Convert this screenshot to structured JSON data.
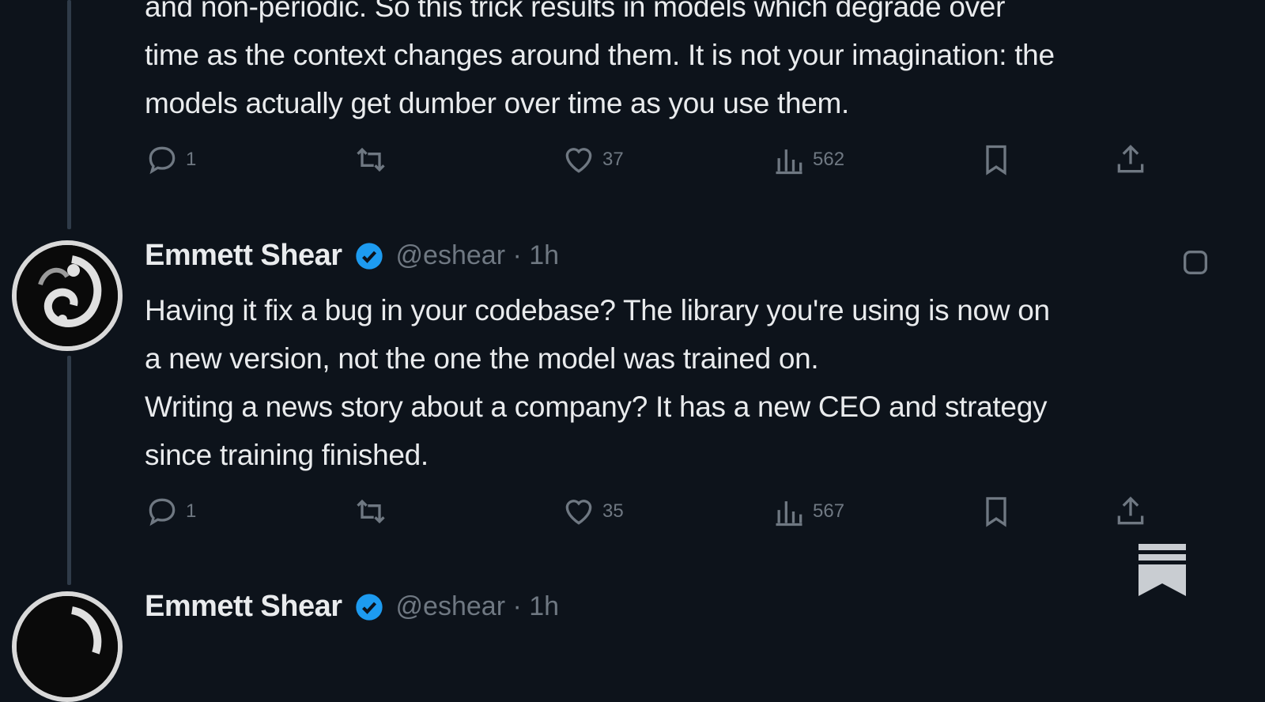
{
  "tweets": [
    {
      "text_lines": [
        "and non-periodic. So this trick results in models which degrade over",
        "time as the context changes around them. It is not your imagination: the",
        "models actually get dumber over time as you use them."
      ],
      "actions": {
        "reply": "1",
        "retweet": "",
        "like": "37",
        "views": "562"
      }
    },
    {
      "author": "Emmett Shear",
      "handle": "@eshear · 1h",
      "text_lines": [
        "Having it fix a bug in your codebase? The library you're using is now on",
        "a new version, not the one the model was trained on.",
        "Writing a news story about a company? It has a new CEO and strategy",
        "since training finished."
      ],
      "actions": {
        "reply": "1",
        "retweet": "",
        "like": "35",
        "views": "567"
      }
    },
    {
      "author": "Emmett Shear",
      "handle": "@eshear · 1h"
    }
  ],
  "icons": {
    "reply": "reply-icon",
    "retweet": "retweet-icon",
    "like": "heart-icon",
    "views": "views-icon",
    "bookmark": "bookmark-icon",
    "share": "share-icon",
    "verified": "verified-badge-icon",
    "more": "more-icon",
    "substack": "substack-logo-icon"
  },
  "colors": {
    "background": "#0d131b",
    "text": "#e9ebed",
    "muted": "#6f7882",
    "verified": "#1d9bf0",
    "thread_line": "#2f3b49"
  }
}
